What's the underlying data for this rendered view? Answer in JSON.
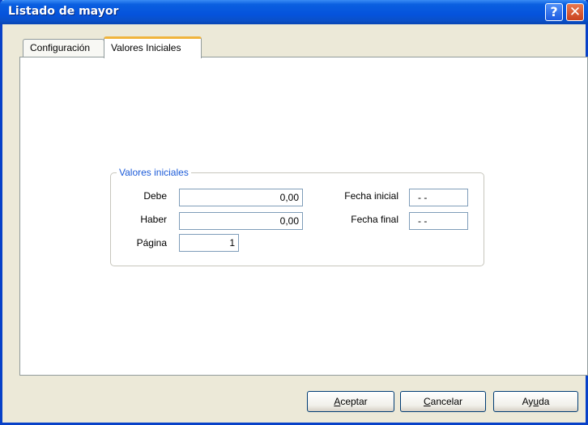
{
  "window": {
    "title": "Listado de mayor",
    "help_icon": "?",
    "close_icon": "✕"
  },
  "tabs": [
    {
      "label": "Configuración",
      "mnemonic": "o",
      "selected": false
    },
    {
      "label": "Valores Iniciales",
      "mnemonic": "V",
      "selected": true
    }
  ],
  "group": {
    "title": "Valores iniciales",
    "debe_label": "Debe",
    "debe_value": "0,00",
    "haber_label": "Haber",
    "haber_value": "0,00",
    "pagina_label": "Página",
    "pagina_value": "1",
    "fecha_inicial_label": "Fecha inicial",
    "fecha_inicial_value": "- -",
    "fecha_final_label": "Fecha final",
    "fecha_final_value": "- -"
  },
  "buttons": {
    "aceptar": {
      "pre": "",
      "key": "A",
      "post": "ceptar"
    },
    "cancelar": {
      "pre": "",
      "key": "C",
      "post": "ancelar"
    },
    "ayuda": {
      "pre": "Ay",
      "key": "u",
      "post": "da"
    }
  },
  "colors": {
    "titlebar": "#0553dc",
    "groupbox_title": "#1c5bd8",
    "tab_highlight": "#f0b43c"
  }
}
